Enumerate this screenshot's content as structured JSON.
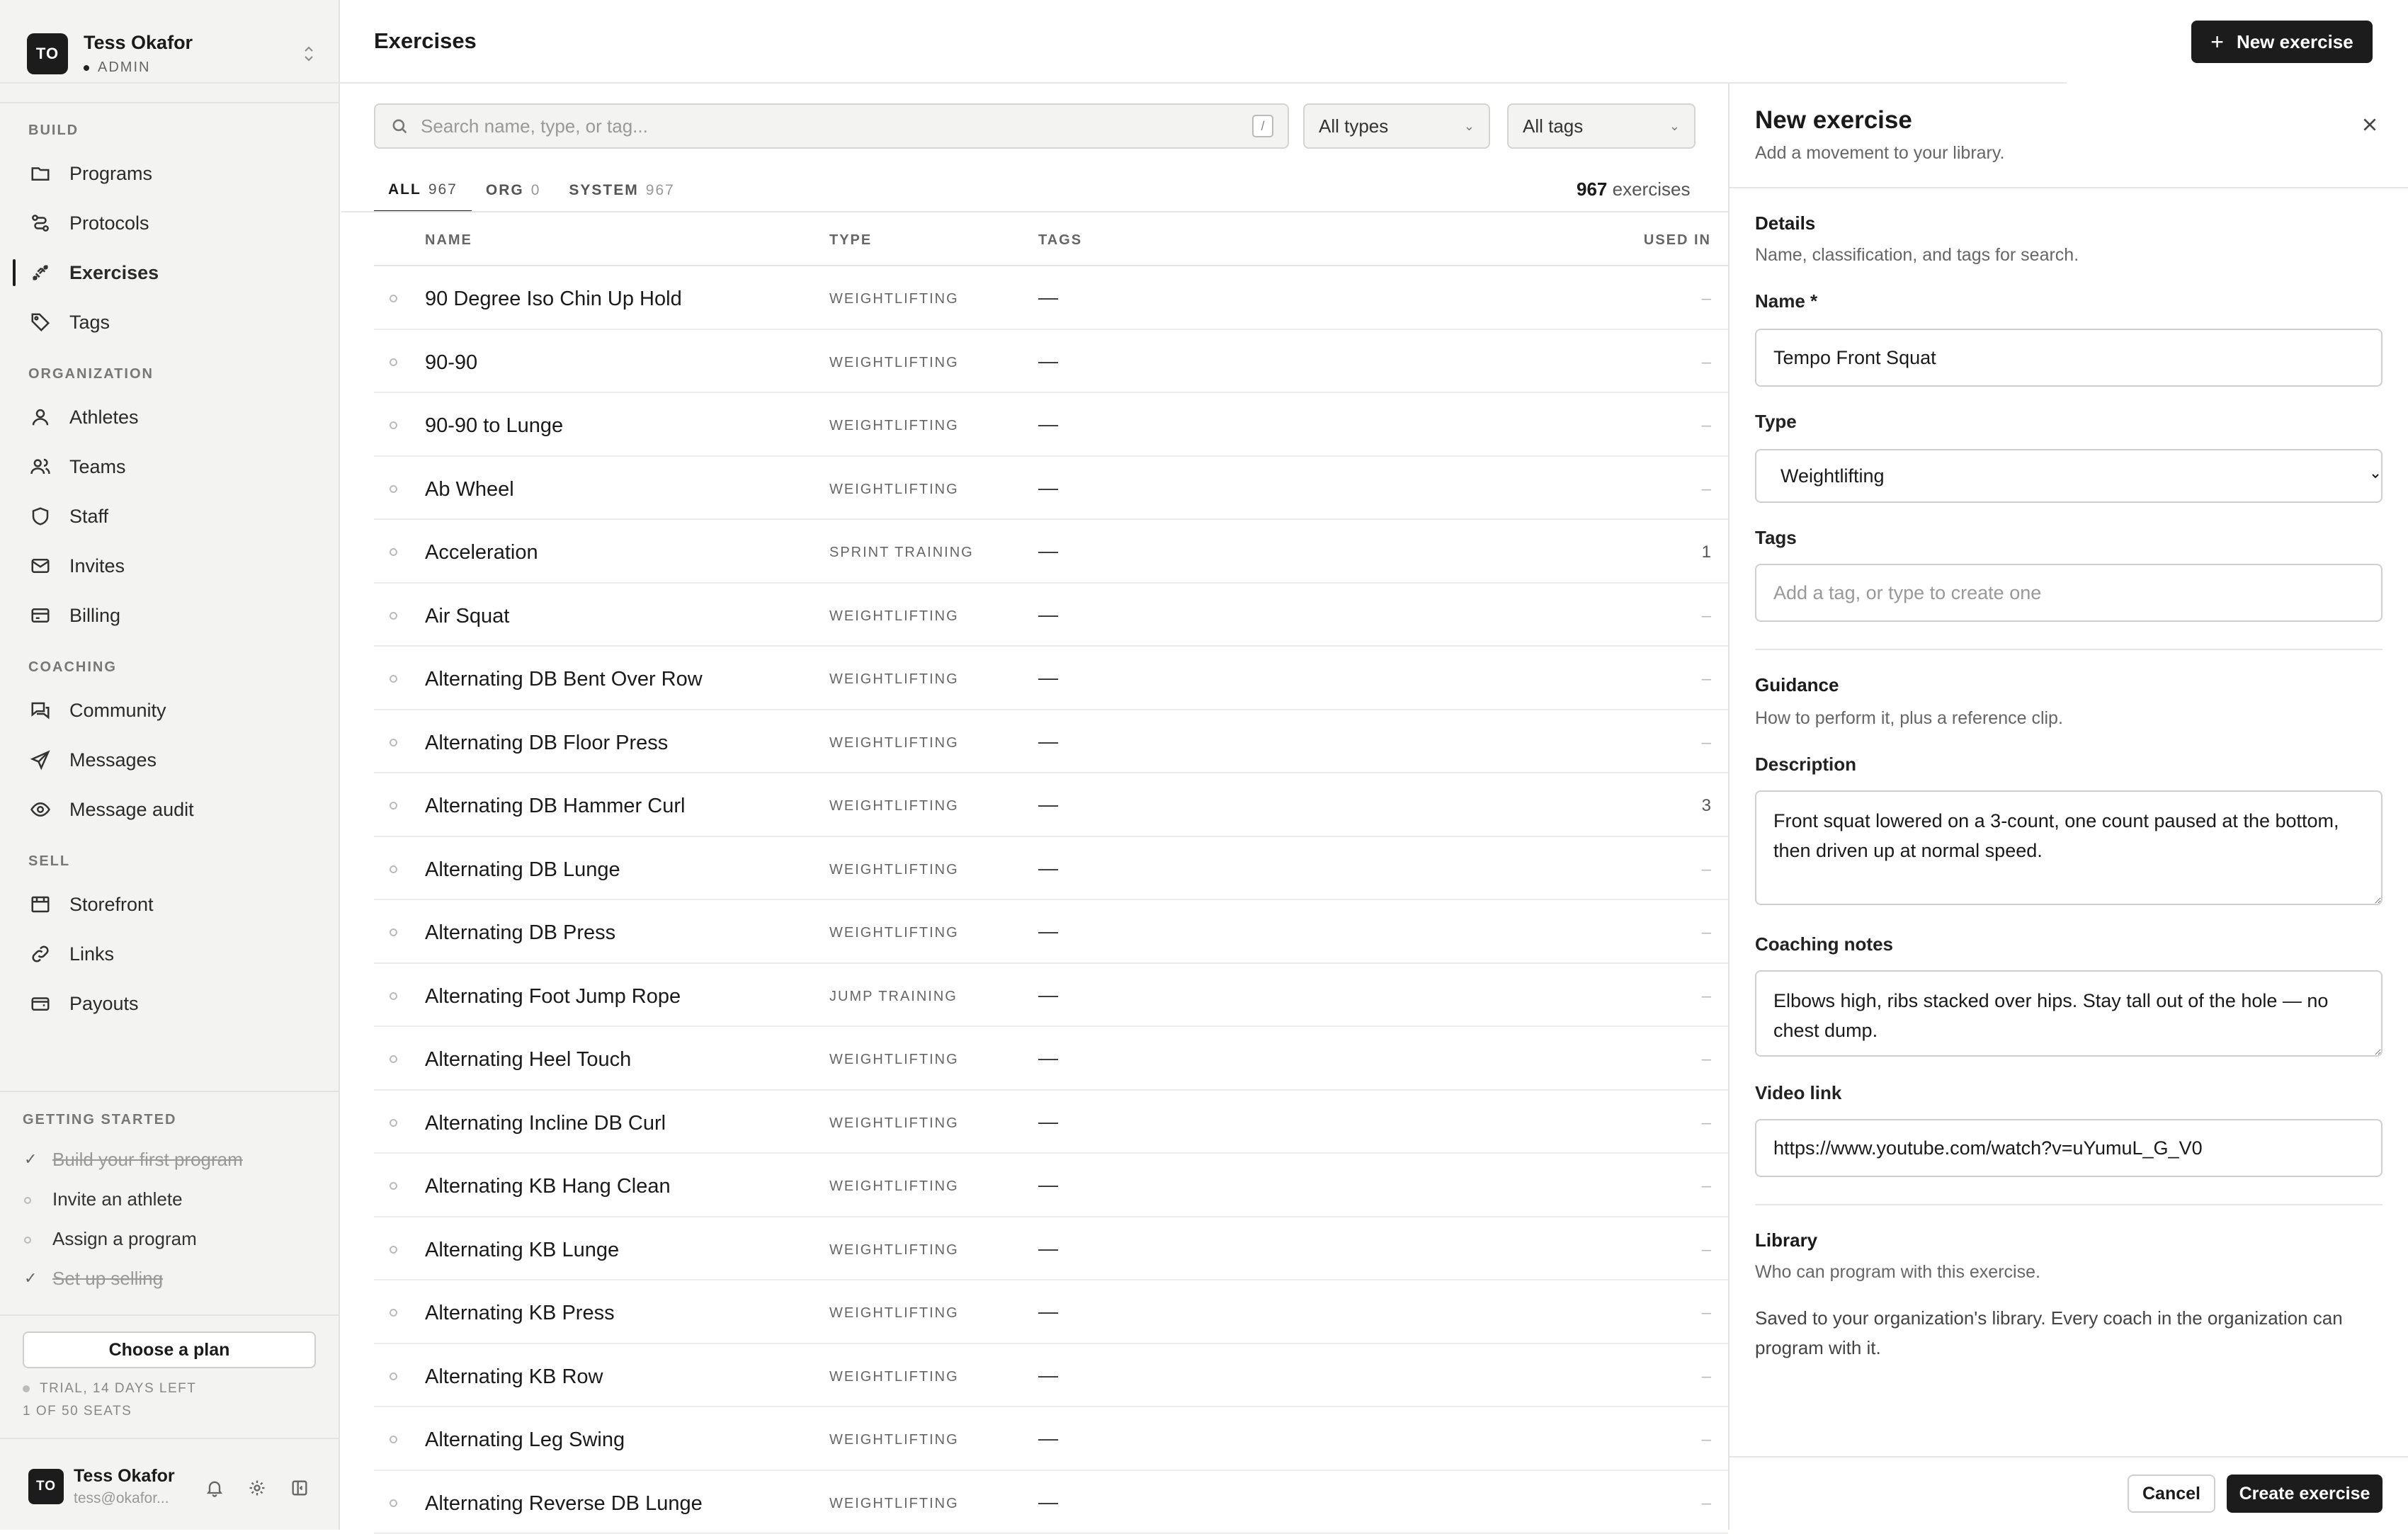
{
  "user": {
    "initials": "TO",
    "name": "Tess Okafor",
    "role": "ADMIN",
    "email": "tess@okafor..."
  },
  "sidebar": {
    "sections": [
      {
        "title": "BUILD",
        "items": [
          {
            "label": "Programs",
            "icon": "folder-icon"
          },
          {
            "label": "Protocols",
            "icon": "route-icon"
          },
          {
            "label": "Exercises",
            "icon": "exercise-icon",
            "active": true
          },
          {
            "label": "Tags",
            "icon": "tag-icon"
          }
        ]
      },
      {
        "title": "ORGANIZATION",
        "items": [
          {
            "label": "Athletes",
            "icon": "user-icon"
          },
          {
            "label": "Teams",
            "icon": "users-icon"
          },
          {
            "label": "Staff",
            "icon": "shield-icon"
          },
          {
            "label": "Invites",
            "icon": "mail-icon"
          },
          {
            "label": "Billing",
            "icon": "credit-card-icon"
          }
        ]
      },
      {
        "title": "COACHING",
        "items": [
          {
            "label": "Community",
            "icon": "chat-icon"
          },
          {
            "label": "Messages",
            "icon": "send-icon"
          },
          {
            "label": "Message audit",
            "icon": "eye-icon"
          }
        ]
      },
      {
        "title": "SELL",
        "items": [
          {
            "label": "Storefront",
            "icon": "store-icon"
          },
          {
            "label": "Links",
            "icon": "link-icon"
          },
          {
            "label": "Payouts",
            "icon": "wallet-icon"
          }
        ]
      }
    ],
    "getting_started": {
      "title": "GETTING STARTED",
      "tasks": [
        {
          "label": "Build your first program",
          "done": true
        },
        {
          "label": "Invite an athlete",
          "done": false
        },
        {
          "label": "Assign a program",
          "done": false
        },
        {
          "label": "Set up selling",
          "done": true
        }
      ]
    },
    "plan_button": "Choose a plan",
    "trial": "TRIAL, 14 DAYS LEFT",
    "seats": "1 OF 50 SEATS"
  },
  "main": {
    "title": "Exercises",
    "new_button": "New exercise",
    "search_placeholder": "Search name, type, or tag...",
    "search_shortcut": "/",
    "filter_type": "All types",
    "filter_tags": "All tags",
    "tabs": [
      {
        "label": "ALL",
        "count": "967",
        "active": true
      },
      {
        "label": "ORG",
        "count": "0"
      },
      {
        "label": "SYSTEM",
        "count": "967"
      }
    ],
    "count_value": "967",
    "count_label": "exercises",
    "columns": {
      "name": "NAME",
      "type": "TYPE",
      "tags": "TAGS",
      "used_in": "USED IN"
    },
    "rows": [
      {
        "name": "90 Degree Iso Chin Up Hold",
        "type": "WEIGHTLIFTING",
        "tags": "—",
        "used": "–"
      },
      {
        "name": "90-90",
        "type": "WEIGHTLIFTING",
        "tags": "—",
        "used": "–"
      },
      {
        "name": "90-90 to Lunge",
        "type": "WEIGHTLIFTING",
        "tags": "—",
        "used": "–"
      },
      {
        "name": "Ab Wheel",
        "type": "WEIGHTLIFTING",
        "tags": "—",
        "used": "–"
      },
      {
        "name": "Acceleration",
        "type": "SPRINT TRAINING",
        "tags": "—",
        "used": "1"
      },
      {
        "name": "Air Squat",
        "type": "WEIGHTLIFTING",
        "tags": "—",
        "used": "–"
      },
      {
        "name": "Alternating DB Bent Over Row",
        "type": "WEIGHTLIFTING",
        "tags": "—",
        "used": "–"
      },
      {
        "name": "Alternating DB Floor Press",
        "type": "WEIGHTLIFTING",
        "tags": "—",
        "used": "–"
      },
      {
        "name": "Alternating DB Hammer Curl",
        "type": "WEIGHTLIFTING",
        "tags": "—",
        "used": "3"
      },
      {
        "name": "Alternating DB Lunge",
        "type": "WEIGHTLIFTING",
        "tags": "—",
        "used": "–"
      },
      {
        "name": "Alternating DB Press",
        "type": "WEIGHTLIFTING",
        "tags": "—",
        "used": "–"
      },
      {
        "name": "Alternating Foot Jump Rope",
        "type": "JUMP TRAINING",
        "tags": "—",
        "used": "–"
      },
      {
        "name": "Alternating Heel Touch",
        "type": "WEIGHTLIFTING",
        "tags": "—",
        "used": "–"
      },
      {
        "name": "Alternating Incline DB Curl",
        "type": "WEIGHTLIFTING",
        "tags": "—",
        "used": "–"
      },
      {
        "name": "Alternating KB Hang Clean",
        "type": "WEIGHTLIFTING",
        "tags": "—",
        "used": "–"
      },
      {
        "name": "Alternating KB Lunge",
        "type": "WEIGHTLIFTING",
        "tags": "—",
        "used": "–"
      },
      {
        "name": "Alternating KB Press",
        "type": "WEIGHTLIFTING",
        "tags": "—",
        "used": "–"
      },
      {
        "name": "Alternating KB Row",
        "type": "WEIGHTLIFTING",
        "tags": "—",
        "used": "–"
      },
      {
        "name": "Alternating Leg Swing",
        "type": "WEIGHTLIFTING",
        "tags": "—",
        "used": "–"
      },
      {
        "name": "Alternating Reverse DB Lunge",
        "type": "WEIGHTLIFTING",
        "tags": "—",
        "used": "–"
      }
    ]
  },
  "panel": {
    "title": "New exercise",
    "subtitle": "Add a movement to your library.",
    "details": {
      "title": "Details",
      "subtitle": "Name, classification, and tags for search."
    },
    "name_label": "Name *",
    "name_value": "Tempo Front Squat",
    "type_label": "Type",
    "type_value": "Weightlifting",
    "tags_label": "Tags",
    "tags_placeholder": "Add a tag, or type to create one",
    "guidance": {
      "title": "Guidance",
      "subtitle": "How to perform it, plus a reference clip."
    },
    "description_label": "Description",
    "description_value": "Front squat lowered on a 3-count, one count paused at the bottom, then driven up at normal speed.",
    "notes_label": "Coaching notes",
    "notes_value": "Elbows high, ribs stacked over hips. Stay tall out of the hole — no chest dump.",
    "video_label": "Video link",
    "video_value": "https://www.youtube.com/watch?v=uYumuL_G_V0",
    "library": {
      "title": "Library",
      "subtitle": "Who can program with this exercise.",
      "text": "Saved to your organization's library. Every coach in the organization can program with it."
    },
    "cancel": "Cancel",
    "create": "Create exercise"
  }
}
